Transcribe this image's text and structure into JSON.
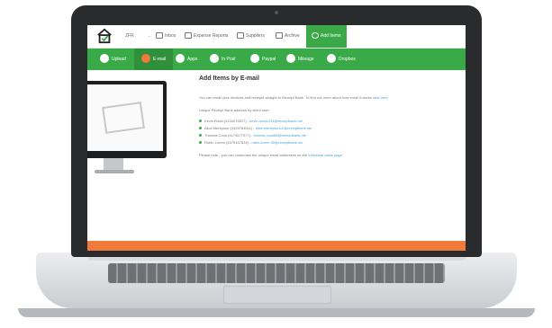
{
  "topnav": {
    "org": "ZFR",
    "items": [
      {
        "label": "Inbox",
        "icon": "inbox-icon"
      },
      {
        "label": "Expense Reports",
        "icon": "reports-icon"
      },
      {
        "label": "Suppliers",
        "icon": "suppliers-icon"
      },
      {
        "label": "Archive",
        "icon": "archive-icon"
      },
      {
        "label": "Add Items",
        "icon": "add-icon",
        "active": true
      }
    ]
  },
  "sources": [
    {
      "label": "Upload",
      "icon": "upload-icon"
    },
    {
      "label": "E-mail",
      "icon": "email-icon",
      "active": true
    },
    {
      "label": "Apps",
      "icon": "apps-icon"
    },
    {
      "label": "In Post",
      "icon": "post-icon"
    },
    {
      "label": "Paypal",
      "icon": "paypal-icon"
    },
    {
      "label": "Mileage",
      "icon": "mileage-icon"
    },
    {
      "label": "Dropbox",
      "icon": "dropbox-icon"
    }
  ],
  "main": {
    "title": "Add Items by E-mail",
    "intro": "You can email your invoices and receipts straight to Receipt Bank. To find out more about how email it works",
    "intro_link": "click here",
    "addresses_heading": "Unique Receipt Bank address by client user:",
    "addresses": [
      {
        "name": "Kevin Rodd (4134276517)",
        "email": "kevin.rodd1234@receiptbank.me"
      },
      {
        "name": "Alice Mereyson (4325764511)",
        "email": "alice.mereyson22@receiptbank.me"
      },
      {
        "name": "Thomas Cook (4174577977)",
        "email": "thomas.cook88@receiptbank.me"
      },
      {
        "name": "Rubin Lorem (4375167824)",
        "email": "rubin.lorem.39@receiptbank.me"
      }
    ],
    "note": "Please note - you can customise the unique email addresses on the",
    "note_link": "Individual users page"
  },
  "colors": {
    "green": "#3aaa48",
    "orange": "#ef7a3b",
    "link": "#4aa3d8"
  }
}
